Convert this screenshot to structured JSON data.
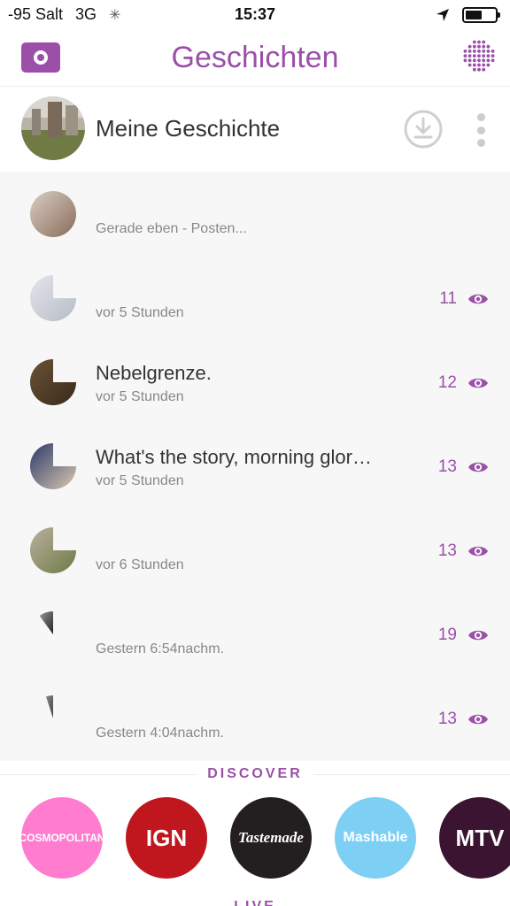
{
  "status_bar": {
    "carrier": "-95 Salt",
    "network": "3G",
    "time": "15:37",
    "battery_level": 0.55
  },
  "header": {
    "title": "Geschichten",
    "camera_icon": "camera-icon",
    "friends_icon": "dot-grid-icon"
  },
  "my_story": {
    "name": "Meine Geschichte",
    "download_icon": "download-icon",
    "more_icon": "vertical-dots-icon"
  },
  "stories": [
    {
      "caption": "",
      "time": "Gerade eben - Posten...",
      "views": "",
      "progress": 1.0
    },
    {
      "caption": "",
      "time": "vor 5 Stunden",
      "views": "11",
      "progress": 0.75
    },
    {
      "caption": "Nebelgrenze.",
      "time": "vor 5 Stunden",
      "views": "12",
      "progress": 0.75
    },
    {
      "caption": "What's the story, morning glor…",
      "time": "vor 5 Stunden",
      "views": "13",
      "progress": 0.75
    },
    {
      "caption": "",
      "time": "vor 6 Stunden",
      "views": "13",
      "progress": 0.75
    },
    {
      "caption": "",
      "time": "Gestern 6:54nachm.",
      "views": "19",
      "progress": 0.1
    },
    {
      "caption": "",
      "time": "Gestern 4:04nachm.",
      "views": "13",
      "progress": 0.05
    }
  ],
  "discover": {
    "label": "DISCOVER",
    "channels": [
      {
        "name": "COSMOPOLITAN",
        "color": "#ff7ccf"
      },
      {
        "name": "IGN",
        "color": "#c0171e"
      },
      {
        "name": "Tastemade",
        "color": "#231f20"
      },
      {
        "name": "Mashable",
        "color": "#7ecff4"
      },
      {
        "name": "MTV",
        "color": "#3a1431"
      }
    ]
  },
  "live_label": "LIVE",
  "colors": {
    "accent": "#9b4fa9",
    "list_background": "#f7f7f7",
    "muted_text": "#888888"
  }
}
